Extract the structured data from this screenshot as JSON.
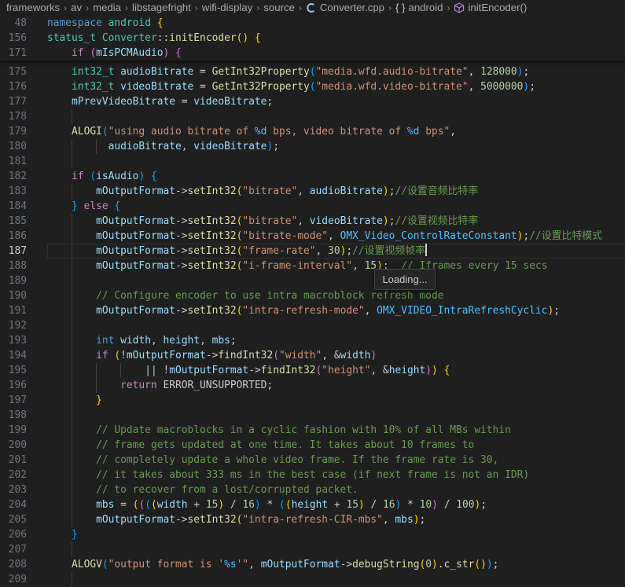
{
  "breadcrumb": {
    "items": [
      "frameworks",
      "av",
      "media",
      "libstagefright",
      "wifi-display",
      "source"
    ],
    "file": "Converter.cpp",
    "namespace": "android",
    "symbol": "initEncoder()"
  },
  "sticky_lines": [
    {
      "num": "48",
      "tokens": [
        [
          "namespace",
          "k"
        ],
        [
          " ",
          "pm"
        ],
        [
          "android",
          "t"
        ],
        [
          " {",
          "y"
        ]
      ]
    },
    {
      "num": "156",
      "tokens": [
        [
          "status_t",
          "t"
        ],
        [
          " ",
          "pm"
        ],
        [
          "Converter",
          "t"
        ],
        [
          "::",
          "pm"
        ],
        [
          "initEncoder",
          "f"
        ],
        [
          "() ",
          "y"
        ],
        [
          "{",
          "y"
        ]
      ]
    },
    {
      "num": "171",
      "tokens": [
        [
          "    ",
          "pm"
        ],
        [
          "if",
          "c"
        ],
        [
          " (",
          "p"
        ],
        [
          "mIsPCMAudio",
          "v"
        ],
        [
          ") ",
          "p"
        ],
        [
          "{",
          "p"
        ]
      ]
    }
  ],
  "code_lines": [
    {
      "num": "175",
      "tokens": [
        [
          "    ",
          "pm"
        ],
        [
          "int32_t",
          "t"
        ],
        [
          " ",
          "pm"
        ],
        [
          "audioBitrate",
          "v"
        ],
        [
          " = ",
          "pm"
        ],
        [
          "GetInt32Property",
          "f"
        ],
        [
          "(",
          "b"
        ],
        [
          "\"media.wfd.audio-bitrate\"",
          "s"
        ],
        [
          ", ",
          "pm"
        ],
        [
          "128000",
          "n"
        ],
        [
          ")",
          "b"
        ],
        [
          ";",
          "pm"
        ]
      ]
    },
    {
      "num": "176",
      "tokens": [
        [
          "    ",
          "pm"
        ],
        [
          "int32_t",
          "t"
        ],
        [
          " ",
          "pm"
        ],
        [
          "videoBitrate",
          "v"
        ],
        [
          " = ",
          "pm"
        ],
        [
          "GetInt32Property",
          "f"
        ],
        [
          "(",
          "b"
        ],
        [
          "\"media.wfd.video-bitrate\"",
          "s"
        ],
        [
          ", ",
          "pm"
        ],
        [
          "5000000",
          "n"
        ],
        [
          ")",
          "b"
        ],
        [
          ";",
          "pm"
        ]
      ]
    },
    {
      "num": "177",
      "tokens": [
        [
          "    ",
          "pm"
        ],
        [
          "mPrevVideoBitrate",
          "v"
        ],
        [
          " = ",
          "pm"
        ],
        [
          "videoBitrate",
          "v"
        ],
        [
          ";",
          "pm"
        ]
      ]
    },
    {
      "num": "178",
      "tokens": []
    },
    {
      "num": "179",
      "tokens": [
        [
          "    ",
          "pm"
        ],
        [
          "ALOGI",
          "f"
        ],
        [
          "(",
          "b"
        ],
        [
          "\"using audio bitrate of ",
          "s"
        ],
        [
          "%d",
          "e"
        ],
        [
          " bps, video bitrate of ",
          "s"
        ],
        [
          "%d",
          "e"
        ],
        [
          " bps\"",
          "s"
        ],
        [
          ",",
          "pm"
        ]
      ]
    },
    {
      "num": "180",
      "tokens": [
        [
          "          ",
          "pm"
        ],
        [
          "audioBitrate",
          "v"
        ],
        [
          ", ",
          "pm"
        ],
        [
          "videoBitrate",
          "v"
        ],
        [
          ")",
          "b"
        ],
        [
          ";",
          "pm"
        ]
      ]
    },
    {
      "num": "181",
      "tokens": []
    },
    {
      "num": "182",
      "tokens": [
        [
          "    ",
          "pm"
        ],
        [
          "if",
          "c"
        ],
        [
          " (",
          "b"
        ],
        [
          "isAudio",
          "v"
        ],
        [
          ") ",
          "b"
        ],
        [
          "{",
          "b"
        ]
      ]
    },
    {
      "num": "183",
      "tokens": [
        [
          "        ",
          "pm"
        ],
        [
          "mOutputFormat",
          "v"
        ],
        [
          "->",
          "pm"
        ],
        [
          "setInt32",
          "f"
        ],
        [
          "(",
          "y"
        ],
        [
          "\"bitrate\"",
          "s"
        ],
        [
          ", ",
          "pm"
        ],
        [
          "audioBitrate",
          "v"
        ],
        [
          ")",
          "y"
        ],
        [
          ";",
          "pm"
        ],
        [
          "//设置音频比特率",
          "cm"
        ]
      ]
    },
    {
      "num": "184",
      "tokens": [
        [
          "    ",
          "pm"
        ],
        [
          "}",
          "b"
        ],
        [
          " ",
          "pm"
        ],
        [
          "else",
          "c"
        ],
        [
          " ",
          "pm"
        ],
        [
          "{",
          "b"
        ]
      ]
    },
    {
      "num": "185",
      "tokens": [
        [
          "        ",
          "pm"
        ],
        [
          "mOutputFormat",
          "v"
        ],
        [
          "->",
          "pm"
        ],
        [
          "setInt32",
          "f"
        ],
        [
          "(",
          "y"
        ],
        [
          "\"bitrate\"",
          "s"
        ],
        [
          ", ",
          "pm"
        ],
        [
          "videoBitrate",
          "v"
        ],
        [
          ")",
          "y"
        ],
        [
          ";",
          "pm"
        ],
        [
          "//设置视频比特率",
          "cm"
        ]
      ]
    },
    {
      "num": "186",
      "tokens": [
        [
          "        ",
          "pm"
        ],
        [
          "mOutputFormat",
          "v"
        ],
        [
          "->",
          "pm"
        ],
        [
          "setInt32",
          "f"
        ],
        [
          "(",
          "y"
        ],
        [
          "\"bitrate-mode\"",
          "s"
        ],
        [
          ", ",
          "pm"
        ],
        [
          "OMX_Video_ControlRateConstant",
          "e"
        ],
        [
          ")",
          "y"
        ],
        [
          ";",
          "pm"
        ],
        [
          "//设置比特模式",
          "cm"
        ]
      ]
    },
    {
      "num": "187",
      "current": true,
      "tokens": [
        [
          "        ",
          "pm"
        ],
        [
          "mOutputFormat",
          "v"
        ],
        [
          "->",
          "pm"
        ],
        [
          "setInt32",
          "f"
        ],
        [
          "(",
          "y"
        ],
        [
          "\"frame-rate\"",
          "s"
        ],
        [
          ", ",
          "pm"
        ],
        [
          "30",
          "n"
        ],
        [
          ")",
          "y"
        ],
        [
          ";",
          "pm"
        ],
        [
          "//设置视频帧率",
          "cm"
        ]
      ]
    },
    {
      "num": "188",
      "tokens": [
        [
          "        ",
          "pm"
        ],
        [
          "mOutputFormat",
          "v"
        ],
        [
          "->",
          "pm"
        ],
        [
          "setInt32",
          "f"
        ],
        [
          "(",
          "y"
        ],
        [
          "\"i-frame-interval\"",
          "s"
        ],
        [
          ", ",
          "pm"
        ],
        [
          "15",
          "n"
        ],
        [
          ")",
          "y"
        ],
        [
          ";  ",
          "pm"
        ],
        [
          "// Iframes every 15 secs",
          "cm"
        ]
      ]
    },
    {
      "num": "189",
      "tokens": []
    },
    {
      "num": "190",
      "tokens": [
        [
          "        ",
          "pm"
        ],
        [
          "// Configure encoder to use intra macroblock refresh mode",
          "cm"
        ]
      ]
    },
    {
      "num": "191",
      "tokens": [
        [
          "        ",
          "pm"
        ],
        [
          "mOutputFormat",
          "v"
        ],
        [
          "->",
          "pm"
        ],
        [
          "setInt32",
          "f"
        ],
        [
          "(",
          "y"
        ],
        [
          "\"intra-refresh-mode\"",
          "s"
        ],
        [
          ", ",
          "pm"
        ],
        [
          "OMX_VIDEO_IntraRefreshCyclic",
          "e"
        ],
        [
          ")",
          "y"
        ],
        [
          ";",
          "pm"
        ]
      ]
    },
    {
      "num": "192",
      "tokens": []
    },
    {
      "num": "193",
      "tokens": [
        [
          "        ",
          "pm"
        ],
        [
          "int",
          "k"
        ],
        [
          " ",
          "pm"
        ],
        [
          "width",
          "v"
        ],
        [
          ", ",
          "pm"
        ],
        [
          "height",
          "v"
        ],
        [
          ", ",
          "pm"
        ],
        [
          "mbs",
          "v"
        ],
        [
          ";",
          "pm"
        ]
      ]
    },
    {
      "num": "194",
      "tokens": [
        [
          "        ",
          "pm"
        ],
        [
          "if",
          "c"
        ],
        [
          " ",
          "pm"
        ],
        [
          "(",
          "y"
        ],
        [
          "!",
          "pm"
        ],
        [
          "mOutputFormat",
          "v"
        ],
        [
          "->",
          "pm"
        ],
        [
          "findInt32",
          "f"
        ],
        [
          "(",
          "p"
        ],
        [
          "\"width\"",
          "s"
        ],
        [
          ", &",
          "pm"
        ],
        [
          "width",
          "v"
        ],
        [
          ")",
          "p"
        ]
      ]
    },
    {
      "num": "195",
      "tokens": [
        [
          "                ",
          "pm"
        ],
        [
          "|| !",
          "pm"
        ],
        [
          "mOutputFormat",
          "v"
        ],
        [
          "->",
          "pm"
        ],
        [
          "findInt32",
          "f"
        ],
        [
          "(",
          "p"
        ],
        [
          "\"height\"",
          "s"
        ],
        [
          ", &",
          "pm"
        ],
        [
          "height",
          "v"
        ],
        [
          ")",
          "p"
        ],
        [
          ")",
          "y"
        ],
        [
          " ",
          "pm"
        ],
        [
          "{",
          "y"
        ]
      ]
    },
    {
      "num": "196",
      "tokens": [
        [
          "            ",
          "pm"
        ],
        [
          "return",
          "c"
        ],
        [
          " ",
          "pm"
        ],
        [
          "ERROR_UNSUPPORTED",
          "pm"
        ],
        [
          ";",
          "pm"
        ]
      ]
    },
    {
      "num": "197",
      "tokens": [
        [
          "        ",
          "pm"
        ],
        [
          "}",
          "y"
        ]
      ]
    },
    {
      "num": "198",
      "tokens": []
    },
    {
      "num": "199",
      "tokens": [
        [
          "        ",
          "pm"
        ],
        [
          "// Update macroblocks in a cyclic fashion with 10% of all MBs within",
          "cm"
        ]
      ]
    },
    {
      "num": "200",
      "tokens": [
        [
          "        ",
          "pm"
        ],
        [
          "// frame gets updated at one time. It takes about 10 frames to",
          "cm"
        ]
      ]
    },
    {
      "num": "201",
      "tokens": [
        [
          "        ",
          "pm"
        ],
        [
          "// completely update a whole video frame. If the frame rate is 30,",
          "cm"
        ]
      ]
    },
    {
      "num": "202",
      "tokens": [
        [
          "        ",
          "pm"
        ],
        [
          "// it takes about 333 ms in the best case (if next frame is not an IDR)",
          "cm"
        ]
      ]
    },
    {
      "num": "203",
      "tokens": [
        [
          "        ",
          "pm"
        ],
        [
          "// to recover from a lost/corrupted packet.",
          "cm"
        ]
      ]
    },
    {
      "num": "204",
      "tokens": [
        [
          "        ",
          "pm"
        ],
        [
          "mbs",
          "v"
        ],
        [
          " = ",
          "pm"
        ],
        [
          "(",
          "y"
        ],
        [
          "(",
          "p"
        ],
        [
          "(",
          "b"
        ],
        [
          "(",
          "y"
        ],
        [
          "width",
          "v"
        ],
        [
          " + ",
          "pm"
        ],
        [
          "15",
          "n"
        ],
        [
          ")",
          "y"
        ],
        [
          " / ",
          "pm"
        ],
        [
          "16",
          "n"
        ],
        [
          ")",
          "b"
        ],
        [
          " * ",
          "pm"
        ],
        [
          "(",
          "b"
        ],
        [
          "(",
          "y"
        ],
        [
          "height",
          "v"
        ],
        [
          " + ",
          "pm"
        ],
        [
          "15",
          "n"
        ],
        [
          ")",
          "y"
        ],
        [
          " / ",
          "pm"
        ],
        [
          "16",
          "n"
        ],
        [
          ")",
          "b"
        ],
        [
          " * ",
          "pm"
        ],
        [
          "10",
          "n"
        ],
        [
          ")",
          "p"
        ],
        [
          " / ",
          "pm"
        ],
        [
          "100",
          "n"
        ],
        [
          ")",
          "y"
        ],
        [
          ";",
          "pm"
        ]
      ]
    },
    {
      "num": "205",
      "tokens": [
        [
          "        ",
          "pm"
        ],
        [
          "mOutputFormat",
          "v"
        ],
        [
          "->",
          "pm"
        ],
        [
          "setInt32",
          "f"
        ],
        [
          "(",
          "y"
        ],
        [
          "\"intra-refresh-CIR-mbs\"",
          "s"
        ],
        [
          ", ",
          "pm"
        ],
        [
          "mbs",
          "v"
        ],
        [
          ")",
          "y"
        ],
        [
          ";",
          "pm"
        ]
      ]
    },
    {
      "num": "206",
      "tokens": [
        [
          "    ",
          "pm"
        ],
        [
          "}",
          "b"
        ]
      ]
    },
    {
      "num": "207",
      "tokens": []
    },
    {
      "num": "208",
      "tokens": [
        [
          "    ",
          "pm"
        ],
        [
          "ALOGV",
          "f"
        ],
        [
          "(",
          "b"
        ],
        [
          "\"output format is '",
          "s"
        ],
        [
          "%s",
          "e"
        ],
        [
          "'\"",
          "s"
        ],
        [
          ", ",
          "pm"
        ],
        [
          "mOutputFormat",
          "v"
        ],
        [
          "->",
          "pm"
        ],
        [
          "debugString",
          "f"
        ],
        [
          "(",
          "y"
        ],
        [
          "0",
          "n"
        ],
        [
          ")",
          "y"
        ],
        [
          ".",
          "pm"
        ],
        [
          "c_str",
          "f"
        ],
        [
          "()",
          "y"
        ],
        [
          ")",
          "b"
        ],
        [
          ";",
          "pm"
        ]
      ]
    },
    {
      "num": "209",
      "tokens": []
    }
  ],
  "tooltip": {
    "text": "Loading..."
  },
  "colors": {
    "background": "#1f1f1f",
    "keyword": "#569cd6",
    "control": "#c586c0",
    "type": "#4ec9b0",
    "variable": "#9cdcfe",
    "function": "#dcdcaa",
    "string": "#ce9178",
    "number": "#b5cea8",
    "comment": "#6a9955",
    "constant": "#4fc1ff"
  }
}
